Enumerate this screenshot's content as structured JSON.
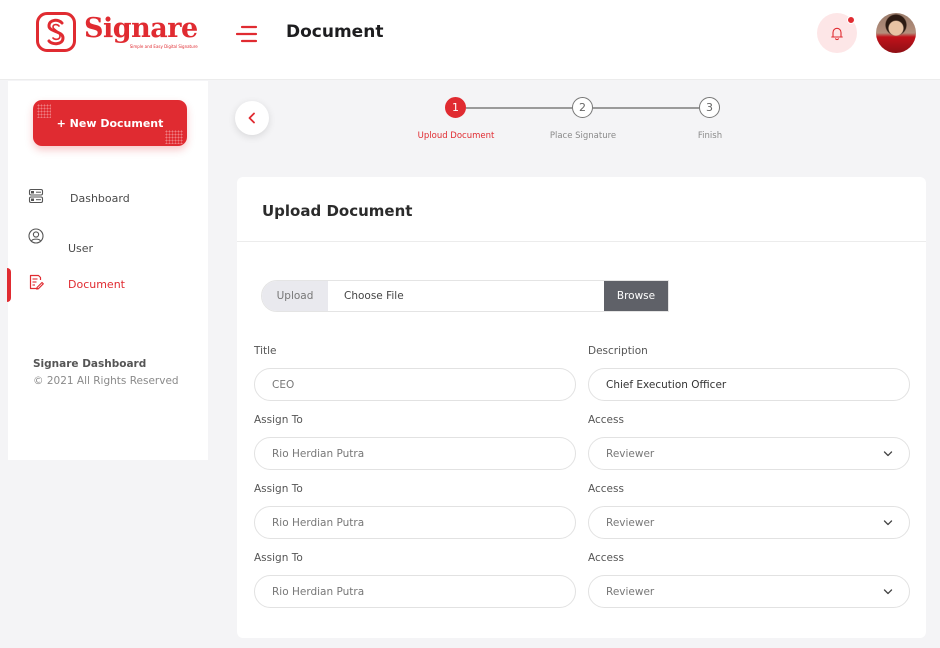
{
  "header": {
    "brand": "Signare",
    "tagline": "Simple and Easy Digital Signature",
    "page_title": "Document",
    "icons": {
      "menu": "menu-icon",
      "notification": "bell-icon"
    },
    "accent_color": "#e02b31"
  },
  "sidebar": {
    "new_button": "+ New Document",
    "items": [
      {
        "label": "Dashboard",
        "icon": "dashboard-icon",
        "active": false
      },
      {
        "label": "User",
        "icon": "user-icon",
        "active": false
      },
      {
        "label": "Document",
        "icon": "document-icon",
        "active": true
      }
    ],
    "footer_title": "Signare Dashboard",
    "footer_copy": "© 2021 All Rights Reserved"
  },
  "stepper": {
    "steps": [
      {
        "number": "1",
        "label": "Uploud Document",
        "active": true
      },
      {
        "number": "2",
        "label": "Place Signature",
        "active": false
      },
      {
        "number": "3",
        "label": "Finish",
        "active": false
      }
    ]
  },
  "form": {
    "card_title": "Upload Document",
    "file": {
      "upload_label": "Upload",
      "placeholder": "Choose File",
      "browse_label": "Browse"
    },
    "title_label": "Title",
    "title_value": "CEO",
    "description_label": "Description",
    "description_value": "Chief Execution Officer",
    "assignments": [
      {
        "assign_label": "Assign To",
        "assign_value": "Rio Herdian Putra",
        "access_label": "Access",
        "access_value": "Reviewer"
      },
      {
        "assign_label": "Assign To",
        "assign_value": "Rio Herdian Putra",
        "access_label": "Access",
        "access_value": "Reviewer"
      },
      {
        "assign_label": "Assign To",
        "assign_value": "Rio Herdian Putra",
        "access_label": "Access",
        "access_value": "Reviewer"
      }
    ]
  }
}
